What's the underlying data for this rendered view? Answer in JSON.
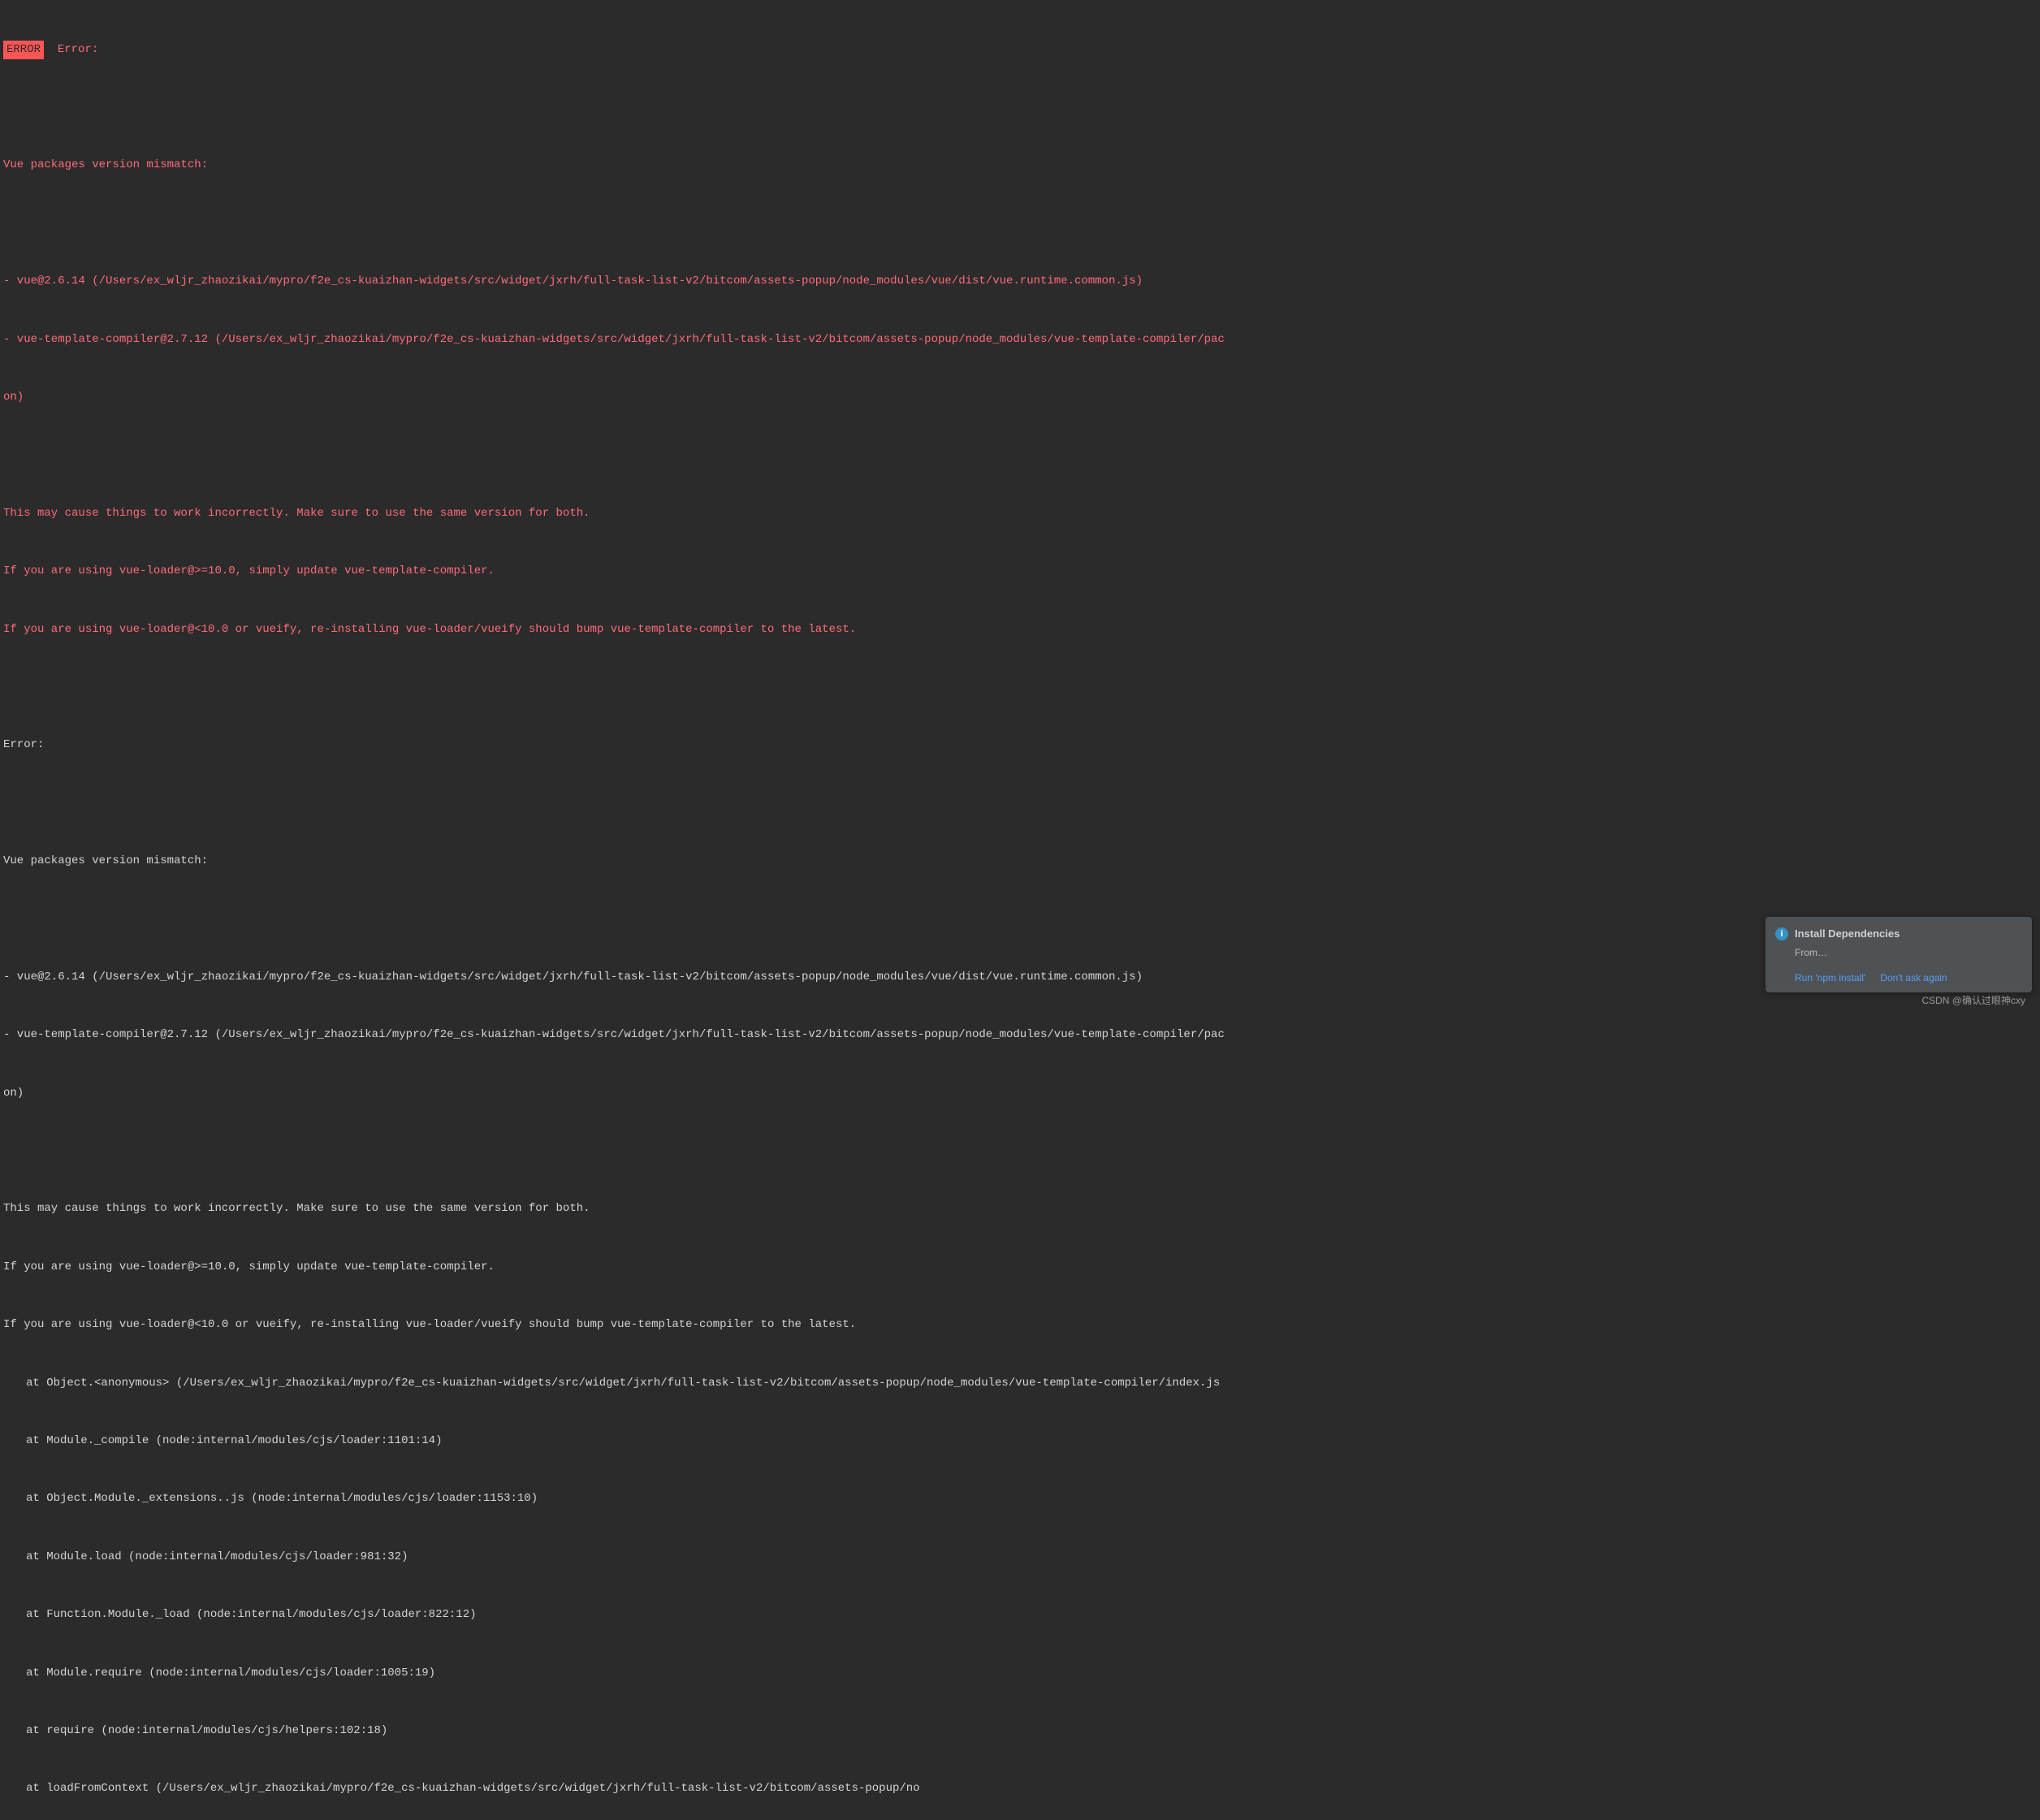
{
  "badge": "ERROR",
  "header_error": "  Error: ",
  "error_block_1": {
    "mismatch": "Vue packages version mismatch:",
    "vue_line": "- vue@2.6.14 (/Users/ex_wljr_zhaozikai/mypro/f2e_cs-kuaizhan-widgets/src/widget/jxrh/full-task-list-v2/bitcom/assets-popup/node_modules/vue/dist/vue.runtime.common.js)",
    "compiler_line": "- vue-template-compiler@2.7.12 (/Users/ex_wljr_zhaozikai/mypro/f2e_cs-kuaizhan-widgets/src/widget/jxrh/full-task-list-v2/bitcom/assets-popup/node_modules/vue-template-compiler/pac",
    "on": "on)",
    "hint1": "This may cause things to work incorrectly. Make sure to use the same version for both.",
    "hint2": "If you are using vue-loader@>=10.0, simply update vue-template-compiler.",
    "hint3": "If you are using vue-loader@<10.0 or vueify, re-installing vue-loader/vueify should bump vue-template-compiler to the latest."
  },
  "error2_label": "Error: ",
  "error_block_2": {
    "mismatch": "Vue packages version mismatch:",
    "vue_line": "- vue@2.6.14 (/Users/ex_wljr_zhaozikai/mypro/f2e_cs-kuaizhan-widgets/src/widget/jxrh/full-task-list-v2/bitcom/assets-popup/node_modules/vue/dist/vue.runtime.common.js)",
    "compiler_line": "- vue-template-compiler@2.7.12 (/Users/ex_wljr_zhaozikai/mypro/f2e_cs-kuaizhan-widgets/src/widget/jxrh/full-task-list-v2/bitcom/assets-popup/node_modules/vue-template-compiler/pac",
    "on": "on)",
    "hint1": "This may cause things to work incorrectly. Make sure to use the same version for both.",
    "hint2": "If you are using vue-loader@>=10.0, simply update vue-template-compiler.",
    "hint3": "If you are using vue-loader@<10.0 or vueify, re-installing vue-loader/vueify should bump vue-template-compiler to the latest."
  },
  "stack": [
    "at Object.<anonymous> (/Users/ex_wljr_zhaozikai/mypro/f2e_cs-kuaizhan-widgets/src/widget/jxrh/full-task-list-v2/bitcom/assets-popup/node_modules/vue-template-compiler/index.js",
    "at Module._compile (node:internal/modules/cjs/loader:1101:14)",
    "at Object.Module._extensions..js (node:internal/modules/cjs/loader:1153:10)",
    "at Module.load (node:internal/modules/cjs/loader:981:32)",
    "at Function.Module._load (node:internal/modules/cjs/loader:822:12)",
    "at Module.require (node:internal/modules/cjs/loader:1005:19)",
    "at require (node:internal/modules/cjs/helpers:102:18)",
    "at loadFromContext (/Users/ex_wljr_zhaozikai/mypro/f2e_cs-kuaizhan-widgets/src/widget/jxrh/full-task-list-v2/bitcom/assets-popup/no"
  ],
  "notification": {
    "title": "Install Dependencies",
    "subtitle": "From…",
    "action_run": "Run 'npm install'",
    "action_dismiss": "Don't ask again"
  },
  "footer_watermark": "CSDN @确认过眼神cxy"
}
